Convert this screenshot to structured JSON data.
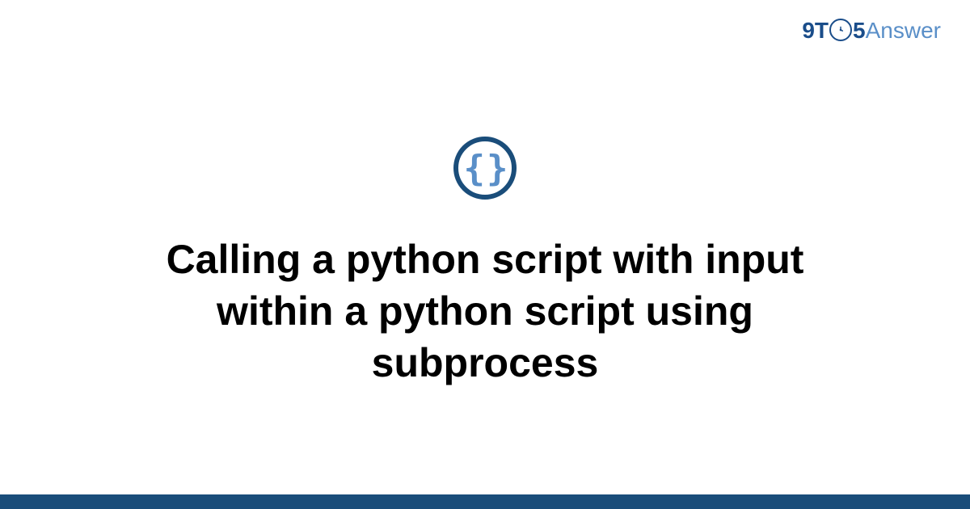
{
  "logo": {
    "part_9t": "9T",
    "part_5": "5",
    "part_answer": "Answer"
  },
  "icon": {
    "label": "code-braces-icon",
    "brace_left": "{",
    "brace_right": "}"
  },
  "title": "Calling a python script with input within a python script using subprocess",
  "colors": {
    "brand_dark": "#1a4d7a",
    "brand_light": "#5a8fc8"
  }
}
